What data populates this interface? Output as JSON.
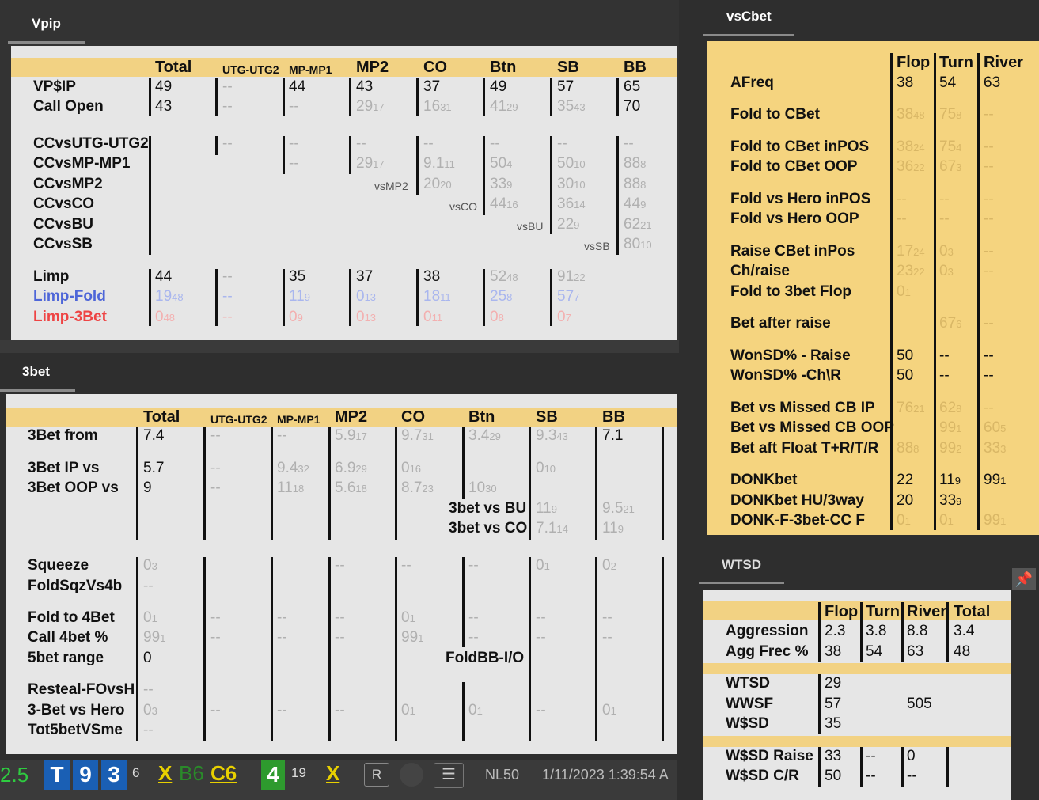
{
  "vpip": {
    "tab": "Vpip",
    "headers": [
      "Total",
      "UTG-UTG2",
      "MP-MP1",
      "MP2",
      "CO",
      "Btn",
      "SB",
      "BB"
    ],
    "row_vpip": {
      "label": "VP$IP",
      "vals": [
        "49",
        "--",
        "44",
        "43",
        "37",
        "49",
        "57",
        "65"
      ]
    },
    "row_callopen": {
      "label": "Call Open",
      "vals": [
        "43",
        "--",
        "--",
        "29",
        "16",
        "41",
        "35",
        "70"
      ],
      "subs": [
        "",
        "",
        "",
        "17",
        "31",
        "29",
        "43",
        ""
      ]
    },
    "cc_labels": [
      "CCvsUTG-UTG2",
      "CCvsMP-MP1",
      "CCvsMP2",
      "CCvsCO",
      "CCvsBU",
      "CCvsSB"
    ],
    "cc_utg": [
      "--"
    ],
    "cc_mp": [
      "--",
      "--"
    ],
    "cc_mp2": [
      "--",
      "29"
    ],
    "cc_co": [
      "--",
      "9.1",
      "20"
    ],
    "cc_btn": [
      "--",
      "50",
      "33",
      "44"
    ],
    "cc_sb": [
      "--",
      "50",
      "30",
      "36",
      "22"
    ],
    "cc_bb": [
      "--",
      "88",
      "88",
      "44",
      "62",
      "80"
    ],
    "vs_labels": [
      "vsMP2",
      "vsCO",
      "vsBU",
      "vsSB"
    ],
    "limp": {
      "label": "Limp",
      "vals": [
        "44",
        "--",
        "35",
        "37",
        "38",
        "52",
        "91"
      ]
    },
    "limpfold": {
      "label": "Limp-Fold",
      "vals": [
        "19",
        "--",
        "11",
        "0",
        "18",
        "25",
        "57"
      ]
    },
    "limp3bet": {
      "label": "Limp-3Bet",
      "vals": [
        "0",
        "--",
        "0",
        "0",
        "0",
        "0",
        "0"
      ]
    }
  },
  "threebet": {
    "tab": "3bet",
    "headers": [
      "Total",
      "UTG-UTG2",
      "MP-MP1",
      "MP2",
      "CO",
      "Btn",
      "SB",
      "BB"
    ],
    "labels": [
      "3Bet from",
      "3Bet IP vs",
      "3Bet OOP vs",
      "Squeeze",
      "FoldSqzVs4b",
      "Fold to 4Bet",
      "Call 4bet %",
      "5bet range",
      "Resteal-FOvsH",
      "3-Bet vs Hero",
      "Tot5betVSme"
    ],
    "from": [
      "7.4",
      "--",
      "--",
      "5.9",
      "9.7",
      "3.4",
      "9.3",
      "7.1"
    ],
    "ip": [
      "5.7",
      "--",
      "9.4",
      "6.9",
      "0",
      "",
      "0"
    ],
    "oop": [
      "9",
      "--",
      "11",
      "5.6",
      "8.7",
      "10"
    ],
    "vsbu_label": "3bet vs BU",
    "vsco_label": "3bet vs CO",
    "vsbu": [
      "11",
      "9.5"
    ],
    "vsco": [
      "7.1",
      "11"
    ],
    "squeeze": [
      "0",
      "--",
      "0",
      "0"
    ],
    "foldsqz": [
      "--"
    ],
    "fold4": [
      "0",
      "--",
      "--",
      "--",
      "0",
      "--",
      "--",
      "--"
    ],
    "call4": [
      "99",
      "--",
      "--",
      "--",
      "99",
      "--",
      "--",
      "--"
    ],
    "fivebet": "0",
    "foldbb_label": "FoldBB-I/O",
    "resteal": [
      "--"
    ],
    "vshero": [
      "0",
      "--",
      "--",
      "--",
      "0",
      "0",
      "--",
      "0"
    ],
    "tot5": [
      "--"
    ]
  },
  "vscbet": {
    "tab": "vsCbet",
    "headers": [
      "Flop",
      "Turn",
      "River"
    ],
    "rows": [
      {
        "label": "AFreq",
        "vals": [
          "38",
          "54",
          "63"
        ]
      },
      {
        "label": "Fold to CBet",
        "vals": [
          "38",
          "75",
          "--"
        ]
      },
      {
        "label": "Fold to CBet inPOS",
        "vals": [
          "38",
          "75",
          "--"
        ]
      },
      {
        "label": "Fold to CBet OOP",
        "vals": [
          "36",
          "67",
          "--"
        ]
      },
      {
        "label": "Fold vs Hero inPOS",
        "vals": [
          "--",
          "--",
          "--"
        ]
      },
      {
        "label": "Fold vs Hero OOP",
        "vals": [
          "--",
          "--",
          "--"
        ]
      },
      {
        "label": "Raise CBet inPos",
        "vals": [
          "17",
          "0",
          "--"
        ]
      },
      {
        "label": "Ch/raise",
        "vals": [
          "23",
          "0",
          "--"
        ]
      },
      {
        "label": "Fold to 3bet Flop",
        "vals": [
          "0",
          "",
          ""
        ]
      },
      {
        "label": "Bet after raise",
        "vals": [
          "",
          "67",
          "--"
        ]
      },
      {
        "label": "WonSD% - Raise",
        "vals": [
          "50",
          "--",
          "--"
        ]
      },
      {
        "label": "WonSD% -Ch\\R",
        "vals": [
          "50",
          "--",
          "--"
        ]
      },
      {
        "label": "Bet vs Missed CB IP",
        "vals": [
          "76",
          "62",
          "--"
        ]
      },
      {
        "label": "Bet vs Missed CB OOP",
        "vals": [
          "",
          "99",
          "60"
        ]
      },
      {
        "label": "Bet aft Float T+R/T/R",
        "vals": [
          "88",
          "99",
          "33"
        ]
      },
      {
        "label": "DONKbet",
        "vals": [
          "22",
          "11",
          "99"
        ]
      },
      {
        "label": "DONKbet HU/3way",
        "vals": [
          "20",
          "33",
          ""
        ]
      },
      {
        "label": "DONK-F-3bet-CC F",
        "vals": [
          "0",
          "0",
          "99"
        ]
      }
    ]
  },
  "wtsd": {
    "tab": "WTSD",
    "headers": [
      "Flop",
      "Turn",
      "River",
      "Total"
    ],
    "aggression": {
      "label": "Aggression",
      "vals": [
        "2.3",
        "3.8",
        "8.8",
        "3.4"
      ]
    },
    "aggfrec": {
      "label": "Agg Frec %",
      "vals": [
        "38",
        "54",
        "63",
        "48"
      ]
    },
    "wtsd": {
      "label": "WTSD",
      "val": "29"
    },
    "wwsf": {
      "label": "WWSF",
      "val": "57",
      "extra": "505"
    },
    "wsd": {
      "label": "W$SD",
      "val": "35"
    },
    "wsdraise": {
      "label": "W$SD Raise",
      "vals": [
        "33",
        "--",
        "0"
      ]
    },
    "wsdcr": {
      "label": "W$SD C/R",
      "vals": [
        "50",
        "--",
        "--"
      ]
    }
  },
  "bottombar": {
    "left": "2.5",
    "badge1": "T",
    "badge2": "9",
    "badge3": "3",
    "sup1": "6",
    "x1": "X",
    "b6": "B6",
    "c6": "C6",
    "four": "4",
    "sup2": "19",
    "x2": "X",
    "r": "R",
    "limit": "NL50",
    "date": "1/11/2023 1:39:54 A"
  }
}
